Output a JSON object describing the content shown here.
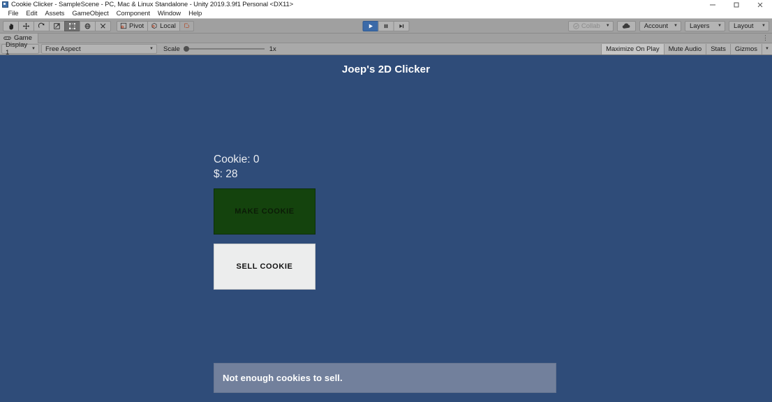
{
  "window": {
    "title": "Cookie Clicker - SampleScene - PC, Mac & Linux Standalone - Unity 2019.3.9f1 Personal <DX11>",
    "icon": "unity-icon",
    "minimize_label": "—",
    "maximize_label": "❑",
    "close_label": "✕"
  },
  "menubar": {
    "items": [
      {
        "label": "File"
      },
      {
        "label": "Edit"
      },
      {
        "label": "Assets"
      },
      {
        "label": "GameObject"
      },
      {
        "label": "Component"
      },
      {
        "label": "Window"
      },
      {
        "label": "Help"
      }
    ]
  },
  "toolbar": {
    "tools": [
      {
        "name": "hand-tool",
        "active": false
      },
      {
        "name": "move-tool",
        "active": false
      },
      {
        "name": "rotate-tool",
        "active": false
      },
      {
        "name": "scale-tool",
        "active": false
      },
      {
        "name": "rect-tool",
        "active": true
      },
      {
        "name": "transform-tool",
        "active": false
      },
      {
        "name": "custom-tool",
        "active": false
      }
    ],
    "pivot_label": "Pivot",
    "local_label": "Local",
    "playback": {
      "play_label": "play-icon",
      "pause_label": "pause-icon",
      "step_label": "step-icon",
      "playing": true
    },
    "collab_label": "Collab",
    "cloud_label": "cloud-icon",
    "account_label": "Account",
    "layers_label": "Layers",
    "layout_label": "Layout"
  },
  "tabbar": {
    "tabs": [
      {
        "label": "Game",
        "icon": "game-icon"
      }
    ],
    "overflow_label": "⋮"
  },
  "gamebar": {
    "display_label": "Display 1",
    "aspect_label": "Free Aspect",
    "scale_label": "Scale",
    "scale_value": "1x",
    "maximize_on_play_label": "Maximize On Play",
    "mute_audio_label": "Mute Audio",
    "stats_label": "Stats",
    "gizmos_label": "Gizmos"
  },
  "game": {
    "title": "Joep's 2D Clicker",
    "cookie_counter": "Cookie: 0",
    "money_counter": "$: 28",
    "make_button_label": "MAKE COOKIE",
    "sell_button_label": "SELL COOKIE",
    "message": "Not enough cookies to sell.",
    "colors": {
      "background": "#2f4c79",
      "make_button": "#14430d",
      "sell_button": "#eceded",
      "message_banner": "#72809c"
    }
  }
}
